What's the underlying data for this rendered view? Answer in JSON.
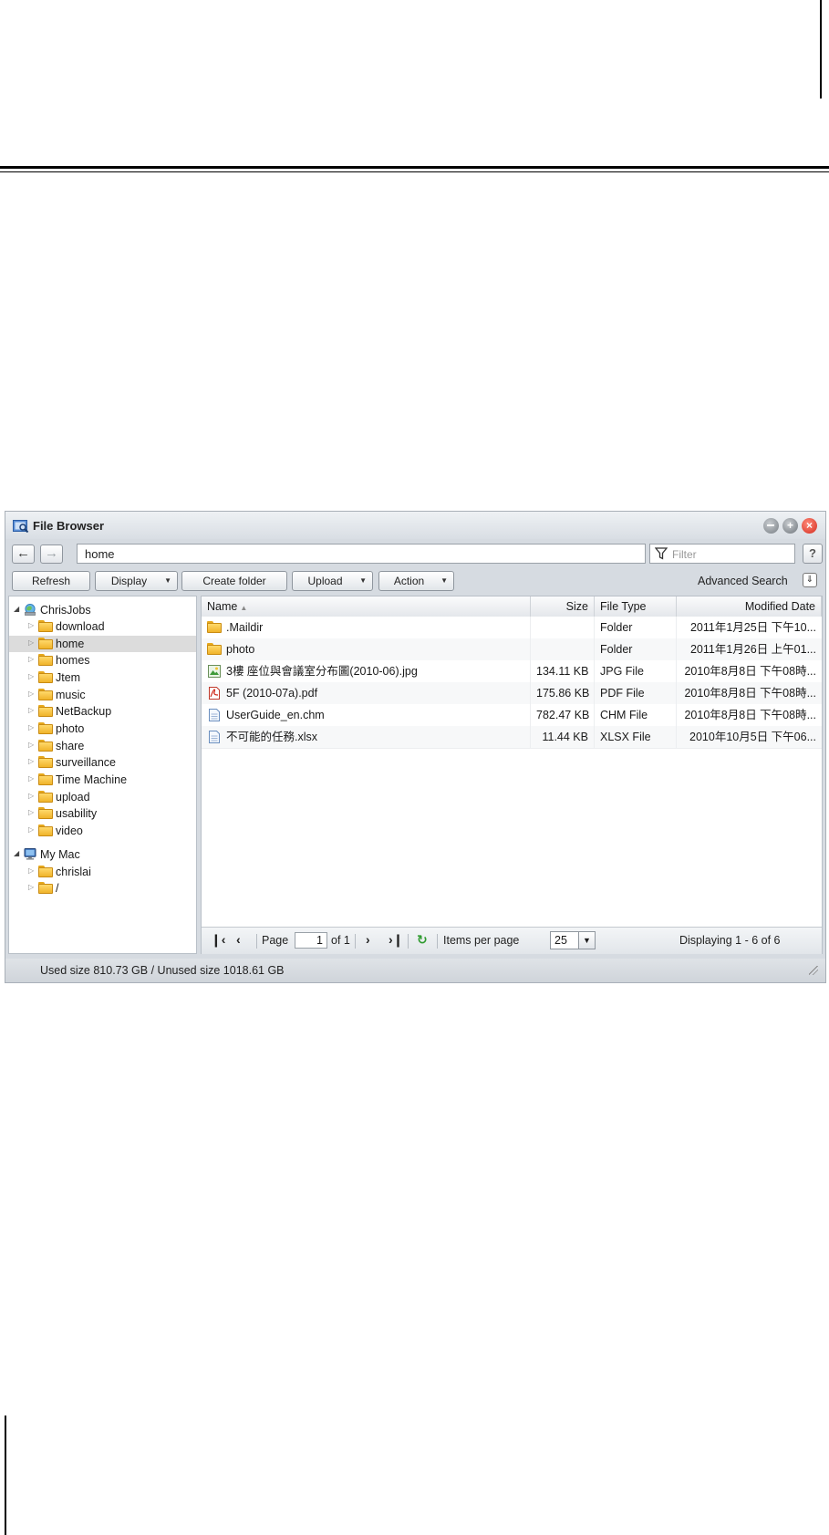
{
  "window": {
    "title": "File Browser",
    "path_value": "home",
    "filter_placeholder": "Filter",
    "help_label": "?"
  },
  "toolbar": {
    "refresh": "Refresh",
    "display": "Display",
    "create_folder": "Create folder",
    "upload": "Upload",
    "action": "Action",
    "advanced_search": "Advanced Search"
  },
  "tree": {
    "roots": [
      {
        "label": "ChrisJobs",
        "icon": "network-drive-icon",
        "children": [
          "download",
          "home",
          "homes",
          "Jtem",
          "music",
          "NetBackup",
          "photo",
          "share",
          "surveillance",
          "Time Machine",
          "upload",
          "usability",
          "video"
        ]
      },
      {
        "label": "My Mac",
        "icon": "computer-icon",
        "children": [
          "chrislai",
          "/"
        ]
      }
    ],
    "selected": "home"
  },
  "grid": {
    "columns": {
      "name": "Name",
      "size": "Size",
      "type": "File Type",
      "date": "Modified Date"
    },
    "rows": [
      {
        "name": ".Maildir",
        "size": "",
        "type": "Folder",
        "date": "2011年1月25日 下午10...",
        "icon": "folder-icon"
      },
      {
        "name": "photo",
        "size": "",
        "type": "Folder",
        "date": "2011年1月26日 上午01...",
        "icon": "folder-icon"
      },
      {
        "name": "3樓 座位與會議室分布圖(2010-06).jpg",
        "size": "134.11 KB",
        "type": "JPG File",
        "date": "2010年8月8日 下午08時...",
        "icon": "image-file-icon"
      },
      {
        "name": "5F (2010-07a).pdf",
        "size": "175.86 KB",
        "type": "PDF File",
        "date": "2010年8月8日 下午08時...",
        "icon": "pdf-file-icon"
      },
      {
        "name": "UserGuide_en.chm",
        "size": "782.47 KB",
        "type": "CHM File",
        "date": "2010年8月8日 下午08時...",
        "icon": "document-file-icon"
      },
      {
        "name": "不可能的任務.xlsx",
        "size": "11.44 KB",
        "type": "XLSX File",
        "date": "2010年10月5日 下午06...",
        "icon": "document-file-icon"
      }
    ]
  },
  "pager": {
    "page_label": "Page",
    "page_value": "1",
    "of_label": "of 1",
    "items_per_page_label": "Items per page",
    "items_per_page_value": "25",
    "displaying": "Displaying 1 - 6 of 6"
  },
  "status": {
    "text": "Used size 810.73 GB / Unused size 1018.61 GB"
  }
}
